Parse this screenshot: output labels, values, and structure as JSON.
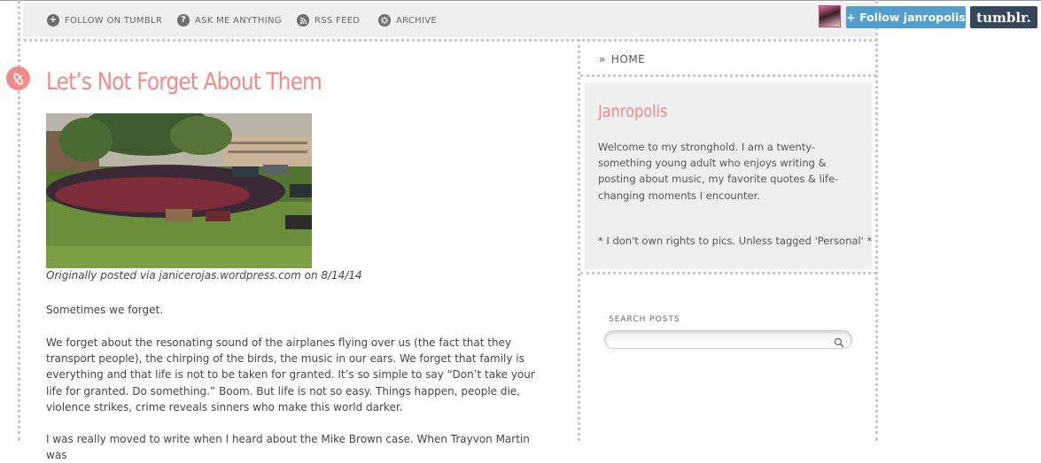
{
  "nav": {
    "items": [
      {
        "label": "FOLLOW ON TUMBLR",
        "icon": "plus-icon"
      },
      {
        "label": "ASK ME ANYTHING",
        "icon": "question-icon"
      },
      {
        "label": "RSS FEED",
        "icon": "rss-icon"
      },
      {
        "label": "ARCHIVE",
        "icon": "archive-icon"
      }
    ]
  },
  "tumblr_controls": {
    "follow_label": "+ Follow janropolis",
    "logo_text": "tumblr."
  },
  "post": {
    "title": "Let’s Not Forget About Them",
    "caption_prefix": "Originally posted via ",
    "caption_source": "janicerojas.wordpress.com",
    "caption_suffix": " on 8/14/14",
    "paragraphs": [
      "Sometimes we forget.",
      "We forget about the resonating sound of the airplanes flying over us (the fact that they transport people), the chirping of the birds, the music in our ears. We forget that family is everything and that life is not to be taken for granted. It’s so simple to say “Don’t take your life for granted. Do something.” Boom. But life is not so easy. Things happen, people die, violence strikes, crime reveals sinners who make this world darker.",
      "I was really moved to write when I heard about the Mike Brown case. When Trayvon Martin was"
    ]
  },
  "sidebar": {
    "home_label": "HOME",
    "blog_name": "Janropolis",
    "description": "Welcome to my stronghold. I am a twenty-something young adult who enjoys writing & posting about music, my favorite quotes & life-changing moments I encounter.",
    "note": "* I don't own rights to pics. Unless tagged 'Personal' *",
    "search_label": "SEARCH POSTS",
    "search_value": ""
  },
  "colors": {
    "accent": "#ef8b8b",
    "follow_button": "#529ecc",
    "tumblr_logo_bg": "#36465d",
    "nav_bg": "#efefef"
  }
}
